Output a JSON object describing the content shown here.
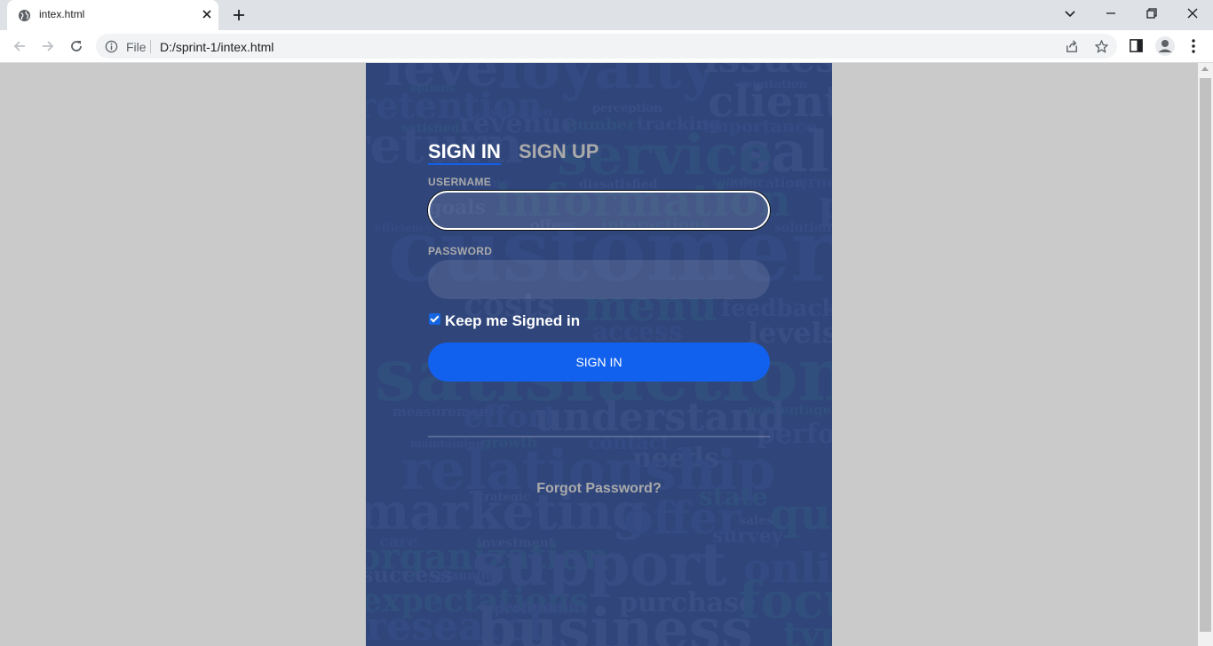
{
  "browser": {
    "tab_title": "intex.html",
    "omnibox_file_label": "File",
    "url": "D:/sprint-1/intex.html"
  },
  "login": {
    "tab_signin": "SIGN IN",
    "tab_signup": "SIGN UP",
    "username_label": "USERNAME",
    "username_value": "",
    "password_label": "PASSWORD",
    "password_value": "",
    "keep_signed_in_label": "Keep me Signed in",
    "keep_signed_in_checked": true,
    "signin_button": "SIGN IN",
    "forgot_link": "Forgot Password?"
  },
  "background_words": [
    "level",
    "loyalty",
    "issues",
    "options",
    "reputation",
    "retention",
    "client",
    "satisfied",
    "revenue",
    "situation",
    "perception",
    "number",
    "tracking",
    "importance",
    "sale",
    "service",
    "return",
    "value",
    "dissatisfied",
    "superior",
    "education",
    "group",
    "goals",
    "information",
    "pro",
    "efficiency",
    "offers",
    "interactions",
    "solution",
    "customer",
    "costs",
    "menu",
    "feedback",
    "access",
    "levels",
    "satisfaction",
    "measurement",
    "effort",
    "understand",
    "percentage",
    "performance",
    "contact",
    "needs",
    "growth",
    "maintaining",
    "relationship",
    "strategic",
    "state",
    "marketing",
    "offer",
    "sales",
    "quality",
    "survey",
    "care",
    "investment",
    "organization",
    "support",
    "online",
    "success",
    "expectations",
    "planning",
    "salesforce",
    "purchase",
    "focus",
    "profitability",
    "research",
    "business",
    "types"
  ],
  "colors": {
    "accent": "#1161ee",
    "overlay": "#324882",
    "page_bg": "#cacaca"
  }
}
